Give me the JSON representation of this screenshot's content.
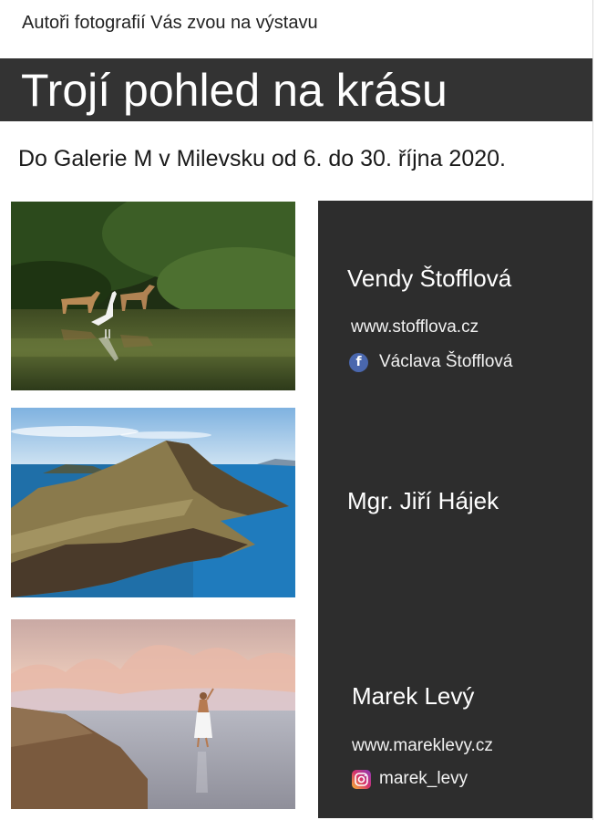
{
  "header": {
    "intro": "Autoři fotografií Vás zvou na výstavu",
    "title": "Trojí pohled na krásu",
    "subtitle": "Do Galerie M v Milevsku od 6. do 30. října 2020."
  },
  "photos": [
    {
      "name": "photo-deer-and-heron"
    },
    {
      "name": "photo-coastal-cliffs"
    },
    {
      "name": "photo-woman-on-beach"
    }
  ],
  "authors": [
    {
      "name": "Vendy Štofflová",
      "website": "www.stofflova.cz",
      "social_label": "Václava Štofflová",
      "social_icon": "facebook-icon"
    },
    {
      "name": "Mgr. Jiří Hájek"
    },
    {
      "name": "Marek Levý",
      "website": "www.mareklevy.cz",
      "social_label": "marek_levy",
      "social_icon": "instagram-icon"
    }
  ],
  "colors": {
    "title_bar": "#333333",
    "panel": "#2d2d2d",
    "facebook": "#4a67ad",
    "instagram": "#d6336c"
  }
}
